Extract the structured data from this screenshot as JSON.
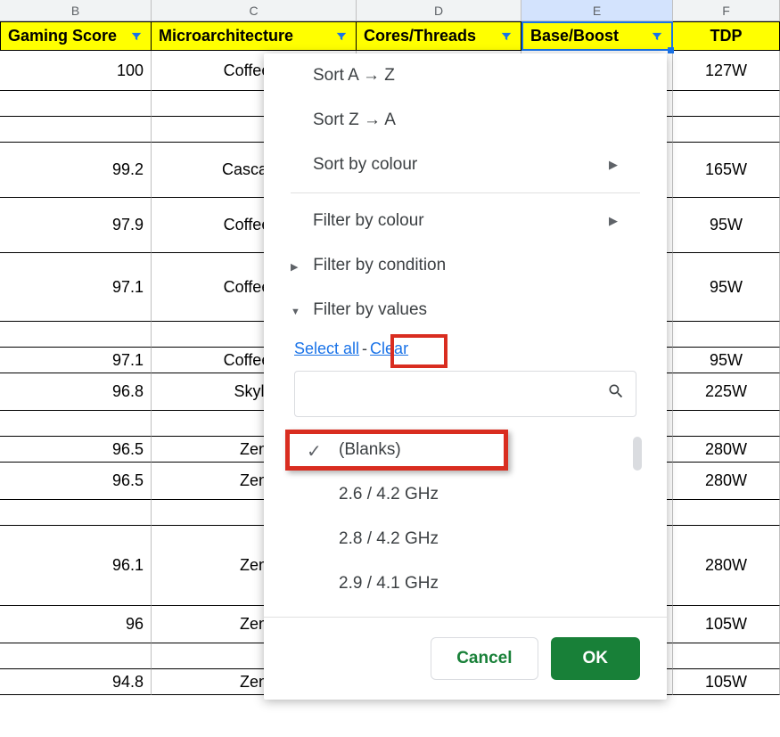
{
  "columns": [
    "B",
    "C",
    "D",
    "E",
    "F"
  ],
  "headers": {
    "B": "Gaming Score",
    "C": "Microarchitecture",
    "D": "Cores/Threads",
    "E": "Base/Boost",
    "F": "TDP"
  },
  "rows": [
    {
      "B": "100",
      "C": "Coffee L",
      "F": "127W",
      "h": "row-45"
    },
    {
      "B": "",
      "C": "",
      "F": "",
      "h": ""
    },
    {
      "B": "",
      "C": "",
      "F": "",
      "h": ""
    },
    {
      "B": "99.2",
      "C": "Cascade",
      "F": "165W",
      "h": "row-62"
    },
    {
      "B": "97.9",
      "C": "Coffee L",
      "F": "95W",
      "h": "row-62"
    },
    {
      "B": "97.1",
      "C": "Coffee L",
      "F": "95W",
      "h": "row-77"
    },
    {
      "B": "",
      "C": "",
      "F": "",
      "h": ""
    },
    {
      "B": "97.1",
      "C": "Coffee L",
      "F": "95W",
      "h": ""
    },
    {
      "B": "96.8",
      "C": "Skyla",
      "F": "225W",
      "h": "row-tall"
    },
    {
      "B": "",
      "C": "",
      "F": "",
      "h": ""
    },
    {
      "B": "96.5",
      "C": "Zen",
      "F": "280W",
      "h": ""
    },
    {
      "B": "96.5",
      "C": "Zen",
      "F": "280W",
      "h": "row-tall"
    },
    {
      "B": "",
      "C": "",
      "F": "",
      "h": ""
    },
    {
      "B": "96.1",
      "C": "Zen",
      "F": "280W",
      "h": "row-90"
    },
    {
      "B": "96",
      "C": "Zen",
      "F": "105W",
      "h": "row-tall"
    },
    {
      "B": "",
      "C": "",
      "F": "",
      "h": ""
    },
    {
      "B": "94.8",
      "C": "Zen",
      "F": "105W",
      "h": ""
    }
  ],
  "menu": {
    "sort_az": "Sort A → Z",
    "sort_za": "Sort Z → A",
    "sort_colour": "Sort by colour",
    "filter_colour": "Filter by colour",
    "filter_condition": "Filter by condition",
    "filter_values": "Filter by values",
    "select_all": "Select all",
    "clear": "Clear",
    "values": {
      "blanks": "(Blanks)",
      "v1": "2.6 / 4.2 GHz",
      "v2": "2.8 / 4.2 GHz",
      "v3": "2.9 / 4.1 GHz"
    },
    "cancel": "Cancel",
    "ok": "OK"
  }
}
